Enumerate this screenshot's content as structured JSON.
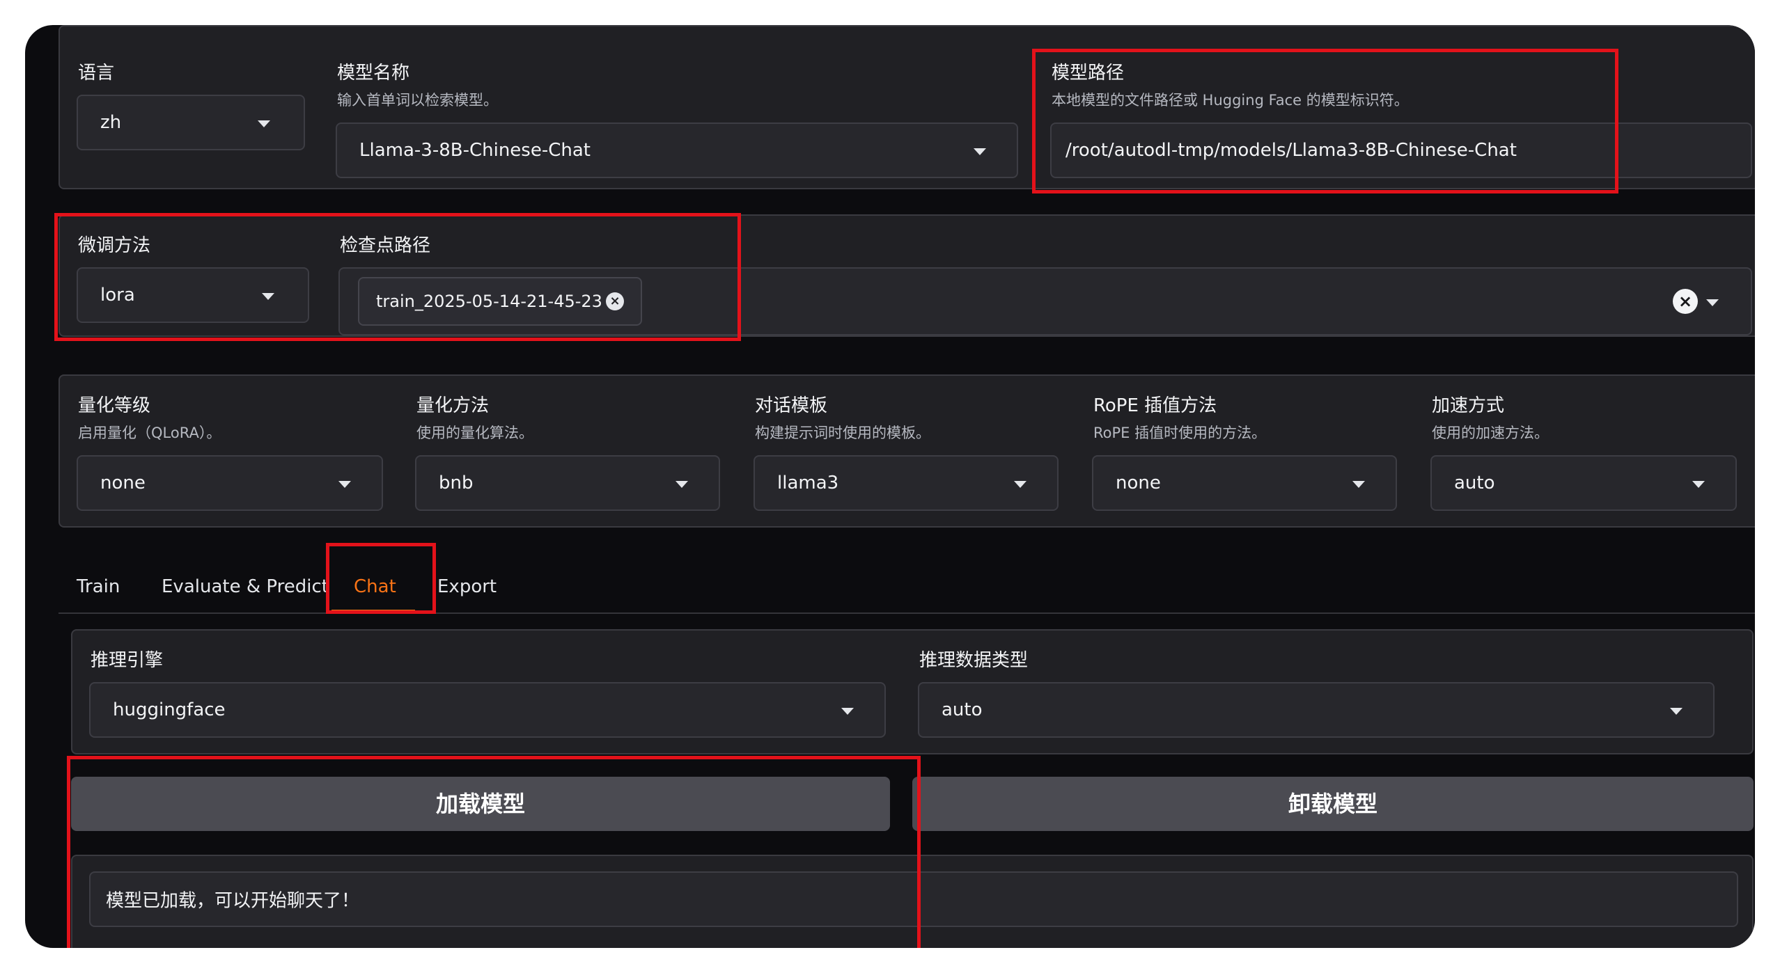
{
  "colors": {
    "accent": "#f97316",
    "highlight": "#e3121a",
    "panel": "#202024",
    "button": "#4b4b52"
  },
  "top": {
    "lang": {
      "label": "语言",
      "value": "zh"
    },
    "model_name": {
      "label": "模型名称",
      "hint": "输入首单词以检索模型。",
      "value": "Llama-3-8B-Chinese-Chat"
    },
    "model_path": {
      "label": "模型路径",
      "hint": "本地模型的文件路径或 Hugging Face 的模型标识符。",
      "value": "/root/autodl-tmp/models/Llama3-8B-Chinese-Chat"
    }
  },
  "finetune": {
    "method": {
      "label": "微调方法",
      "value": "lora"
    },
    "checkpoint": {
      "label": "检查点路径",
      "tags": [
        "train_2025-05-14-21-45-23"
      ]
    }
  },
  "quant": {
    "level": {
      "label": "量化等级",
      "hint": "启用量化（QLoRA）。",
      "value": "none"
    },
    "method": {
      "label": "量化方法",
      "hint": "使用的量化算法。",
      "value": "bnb"
    },
    "template": {
      "label": "对话模板",
      "hint": "构建提示词时使用的模板。",
      "value": "llama3"
    },
    "rope": {
      "label": "RoPE 插值方法",
      "hint": "RoPE 插值时使用的方法。",
      "value": "none"
    },
    "accel": {
      "label": "加速方式",
      "hint": "使用的加速方法。",
      "value": "auto"
    }
  },
  "tabs": [
    "Train",
    "Evaluate & Predict",
    "Chat",
    "Export"
  ],
  "active_tab": "Chat",
  "chat": {
    "engine": {
      "label": "推理引擎",
      "value": "huggingface"
    },
    "dtype": {
      "label": "推理数据类型",
      "value": "auto"
    },
    "load_button": "加载模型",
    "unload_button": "卸载模型",
    "status": "模型已加载，可以开始聊天了！"
  },
  "icons": {
    "tag_remove": "x-circle-icon",
    "clear": "clear-icon",
    "dropdown": "chevron-down-icon"
  }
}
